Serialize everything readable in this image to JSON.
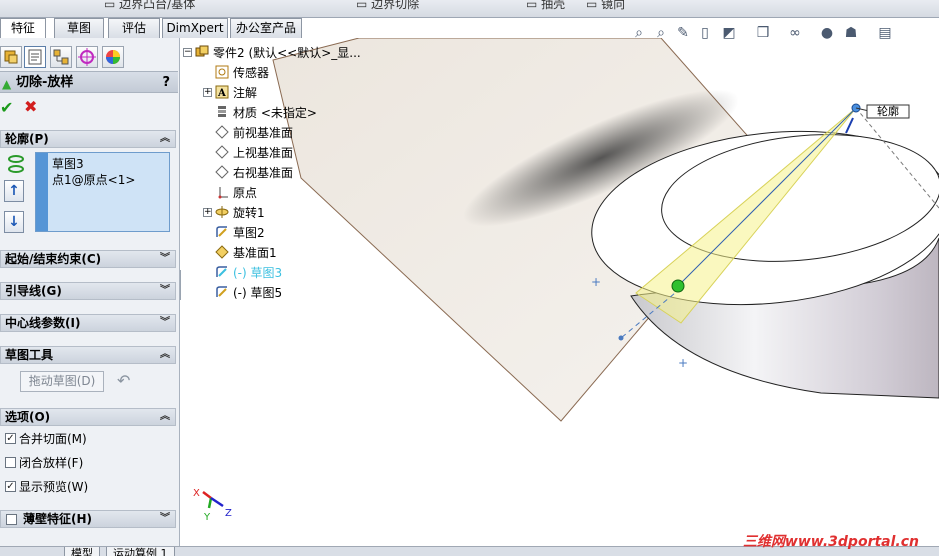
{
  "top_strip": {
    "item1": "边界凸台/基体",
    "item2": "边界切除",
    "item3": "抽壳",
    "item4": "镜向"
  },
  "tabs": [
    {
      "label": "特征"
    },
    {
      "label": "草图"
    },
    {
      "label": "评估"
    },
    {
      "label": "DimXpert"
    },
    {
      "label": "办公室产品"
    }
  ],
  "property_manager": {
    "title": "切除-放样",
    "help": "?",
    "ok_symbol": "✔",
    "cancel_symbol": "✖",
    "profile_group": "轮廓(P)",
    "profile_items": [
      "草图3",
      "点1@原点<1>"
    ],
    "groups": {
      "start_end": "起始/结束约束(C)",
      "guides": "引导线(G)",
      "centerline": "中心线参数(I)",
      "sketch_tools": "草图工具",
      "options": "选项(O)",
      "thin_feature": "薄壁特征(H)"
    },
    "drag_sketch_label": "拖动草图(D)",
    "options": [
      {
        "label": "合并切面(M)",
        "checked": true
      },
      {
        "label": "闭合放样(F)",
        "checked": false
      },
      {
        "label": "显示预览(W)",
        "checked": true
      }
    ]
  },
  "feature_tree": {
    "root": "零件2 (默认<<默认>_显...",
    "items": [
      {
        "label": "传感器",
        "icon": "sensor-icon"
      },
      {
        "label": "注解",
        "icon": "annotation-icon",
        "expandable": true
      },
      {
        "label": "材质 <未指定>",
        "icon": "material-icon"
      },
      {
        "label": "前视基准面",
        "icon": "plane-icon"
      },
      {
        "label": "上视基准面",
        "icon": "plane-icon"
      },
      {
        "label": "右视基准面",
        "icon": "plane-icon"
      },
      {
        "label": "原点",
        "icon": "origin-icon"
      },
      {
        "label": "旋转1",
        "icon": "revolve-icon",
        "expandable": true
      },
      {
        "label": "草图2",
        "icon": "sketch-icon"
      },
      {
        "label": "基准面1",
        "icon": "plane-icon"
      },
      {
        "label": "(-) 草图3",
        "icon": "sketch-icon",
        "highlight": true
      },
      {
        "label": "(-) 草图5",
        "icon": "sketch-icon"
      }
    ]
  },
  "viewport": {
    "callout_label": "轮廓",
    "triad": {
      "x": "X",
      "y": "Y",
      "z": "Z"
    }
  },
  "bottom_tabs": [
    "模型",
    "运动算例 1"
  ],
  "watermark": "三维网www.3dportal.cn",
  "colors": {
    "accent": "#5595d6",
    "ok": "#1b9a1b",
    "cancel": "#d21e1e",
    "highlight_text": "#3cc0e0",
    "watermark": "#e03030"
  }
}
